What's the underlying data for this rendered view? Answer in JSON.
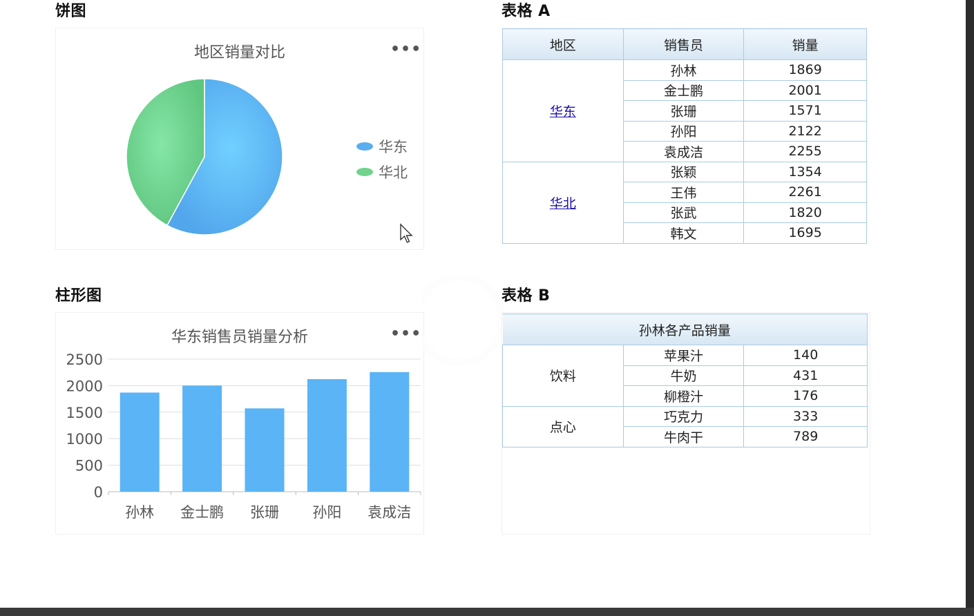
{
  "pie_section": {
    "title": "饼图",
    "chart_title": "地区销量对比",
    "menu": "•••"
  },
  "bar_section": {
    "title": "柱形图",
    "chart_title": "华东销售员销量分析",
    "menu": "•••"
  },
  "table_a": {
    "title": "表格 A",
    "headers": [
      "地区",
      "销售员",
      "销量"
    ],
    "groups": [
      {
        "region": "华东",
        "rows": [
          [
            "孙林",
            "1869"
          ],
          [
            "金士鹏",
            "2001"
          ],
          [
            "张珊",
            "1571"
          ],
          [
            "孙阳",
            "2122"
          ],
          [
            "袁成洁",
            "2255"
          ]
        ]
      },
      {
        "region": "华北",
        "rows": [
          [
            "张颖",
            "1354"
          ],
          [
            "王伟",
            "2261"
          ],
          [
            "张武",
            "1820"
          ],
          [
            "韩文",
            "1695"
          ]
        ]
      }
    ]
  },
  "table_b": {
    "title": "表格 B",
    "header": "孙林各产品销量",
    "groups": [
      {
        "category": "饮料",
        "rows": [
          [
            "苹果汁",
            "140"
          ],
          [
            "牛奶",
            "431"
          ],
          [
            "柳橙汁",
            "176"
          ]
        ]
      },
      {
        "category": "点心",
        "rows": [
          [
            "巧克力",
            "333"
          ],
          [
            "牛肉干",
            "789"
          ]
        ]
      }
    ]
  },
  "chart_data": [
    {
      "type": "pie",
      "title": "地区销量对比",
      "labels": [
        "华东",
        "华北"
      ],
      "values": [
        9818,
        7130
      ],
      "colors": [
        "#5aaeee",
        "#6fd38d"
      ],
      "legend": "right"
    },
    {
      "type": "bar",
      "title": "华东销售员销量分析",
      "categories": [
        "孙林",
        "金士鹏",
        "张珊",
        "孙阳",
        "袁成洁"
      ],
      "values": [
        1869,
        2001,
        1571,
        2122,
        2255
      ],
      "ylim": [
        0,
        2500
      ],
      "yticks": [
        "0",
        "500",
        "1000",
        "1500",
        "2000",
        "2500"
      ],
      "grid": true,
      "color": "#5ab4f5"
    }
  ]
}
